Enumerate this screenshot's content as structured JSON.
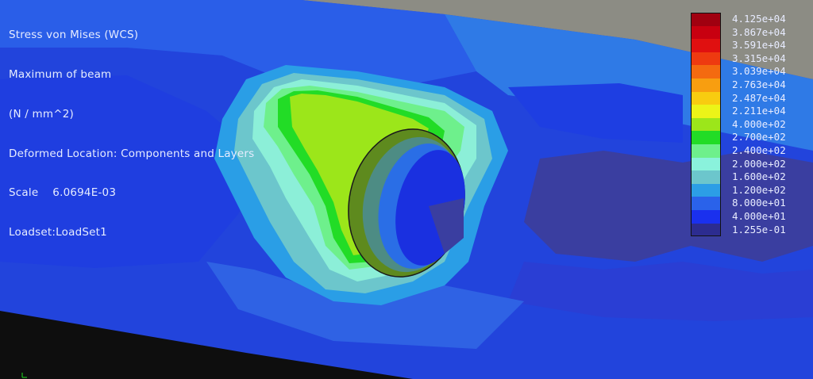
{
  "info": {
    "title": "Stress von Mises (WCS)",
    "subtitle": "Maximum of beam",
    "units": "(N / mm^2)",
    "location": "Deformed Location: Components and Layers",
    "scale": "Scale    6.0694E-03",
    "loadset": "Loadset:LoadSet1"
  },
  "legend": {
    "entries": [
      {
        "label": "4.125e+04",
        "color": "#a00010"
      },
      {
        "label": "3.867e+04",
        "color": "#c80010"
      },
      {
        "label": "3.591e+04",
        "color": "#e01010"
      },
      {
        "label": "3.315e+04",
        "color": "#ee3a10"
      },
      {
        "label": "3.039e+04",
        "color": "#f46a10"
      },
      {
        "label": "2.763e+04",
        "color": "#f89e10"
      },
      {
        "label": "2.487e+04",
        "color": "#f8cc10"
      },
      {
        "label": "2.211e+04",
        "color": "#ecf418"
      },
      {
        "label": "4.000e+02",
        "color": "#9ce61a"
      },
      {
        "label": "2.700e+02",
        "color": "#22dc26"
      },
      {
        "label": "2.400e+02",
        "color": "#6ef08c"
      },
      {
        "label": "2.000e+02",
        "color": "#8af2dc"
      },
      {
        "label": "1.600e+02",
        "color": "#6cc6cc"
      },
      {
        "label": "1.200e+02",
        "color": "#2c9ee6"
      },
      {
        "label": "8.000e+01",
        "color": "#2a62ea"
      },
      {
        "label": "4.000e+01",
        "color": "#1a30ee"
      },
      {
        "label": "1.255e-01",
        "color": "#2c2c90"
      }
    ]
  },
  "colors": {
    "background_band": "#8a8a82",
    "lower_band": "#111111"
  }
}
